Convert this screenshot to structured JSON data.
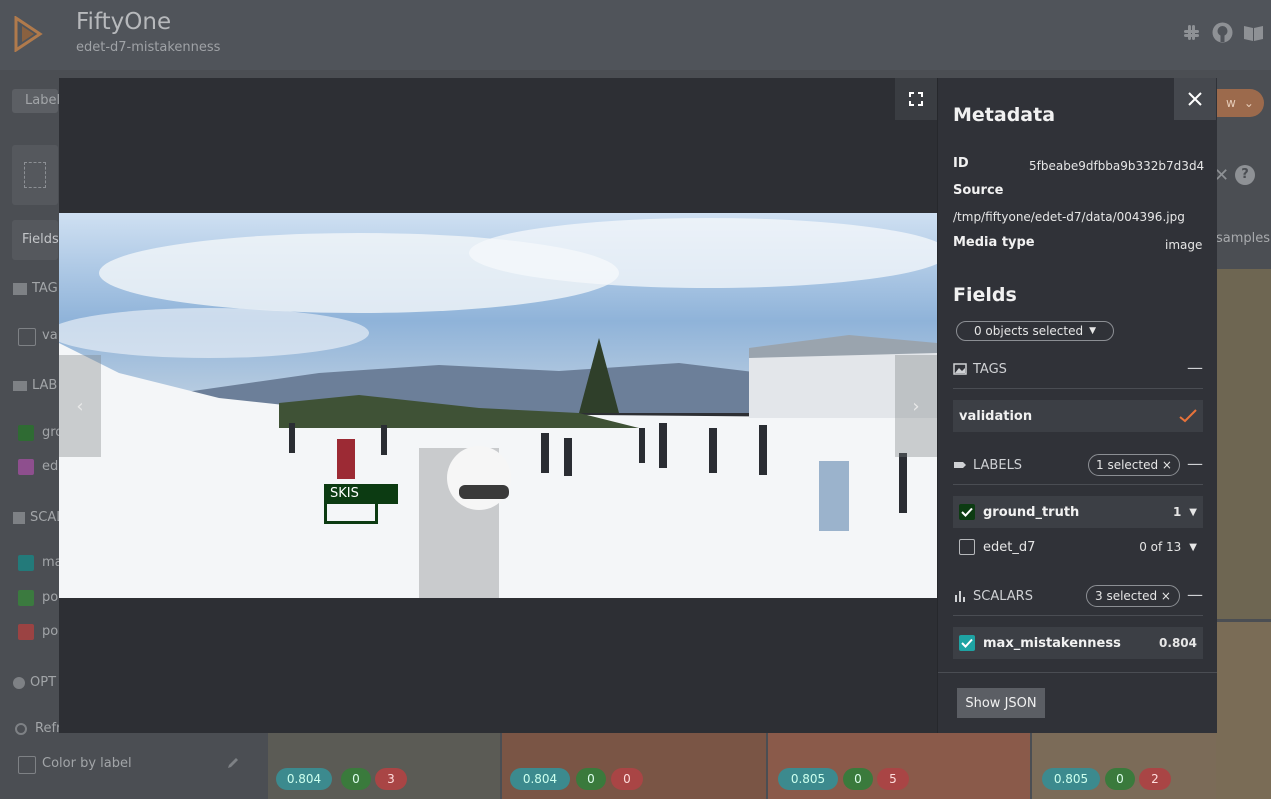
{
  "app": {
    "title": "FiftyOne",
    "dataset": "edet-d7-mistakenness"
  },
  "background": {
    "tab_label": "Label",
    "fields_tab": "Fields",
    "tags_heading": "TAG",
    "tag_item": "va",
    "labels_heading": "LAB",
    "label_items": [
      "gro",
      "ede"
    ],
    "scalars_heading": "SCAL",
    "scalar_items": [
      "ma",
      "po",
      "pos"
    ],
    "options_heading": "OPT",
    "refresh_label": "Refresh field colors",
    "color_by_label": "Color by label",
    "samples_label": "samples",
    "view_button": "w",
    "thumb_badges": [
      {
        "score": "0.804",
        "green": "0",
        "red": "3"
      },
      {
        "score": "0.804",
        "green": "0",
        "red": "0"
      },
      {
        "score": "0.805",
        "green": "0",
        "red": "5"
      },
      {
        "score": "0.805",
        "green": "0",
        "red": "2"
      }
    ]
  },
  "modal": {
    "detection_label": "SKIS",
    "metadata": {
      "heading": "Metadata",
      "id_key": "ID",
      "id_value": "5fbeabe9dfbba9b332b7d3d4",
      "source_key": "Source",
      "source_value": "/tmp/fiftyone/edet-d7/data/004396.jpg",
      "media_type_key": "Media type",
      "media_type_value": "image"
    },
    "fields": {
      "heading": "Fields",
      "objects_selected": "0 objects selected",
      "tags_heading": "TAGS",
      "tag_rows": [
        {
          "label": "validation"
        }
      ],
      "labels_heading": "LABELS",
      "labels_selected": "1 selected ×",
      "label_rows": [
        {
          "label": "ground_truth",
          "count": "1",
          "checked": true,
          "color": "#0c3b12"
        },
        {
          "label": "edet_d7",
          "count": "0 of 13",
          "checked": false
        }
      ],
      "scalars_heading": "SCALARS",
      "scalars_selected": "3 selected ×",
      "scalar_rows": [
        {
          "label": "max_mistakenness",
          "value": "0.804",
          "checked": true,
          "color": "#1ea3a3"
        }
      ]
    },
    "show_json": "Show JSON"
  },
  "colors": {
    "accent_orange": "#e8733a",
    "teal": "#1ea3a3",
    "green": "#3e9d45",
    "red": "#c94a4a",
    "dark_green": "#0c3b12"
  }
}
